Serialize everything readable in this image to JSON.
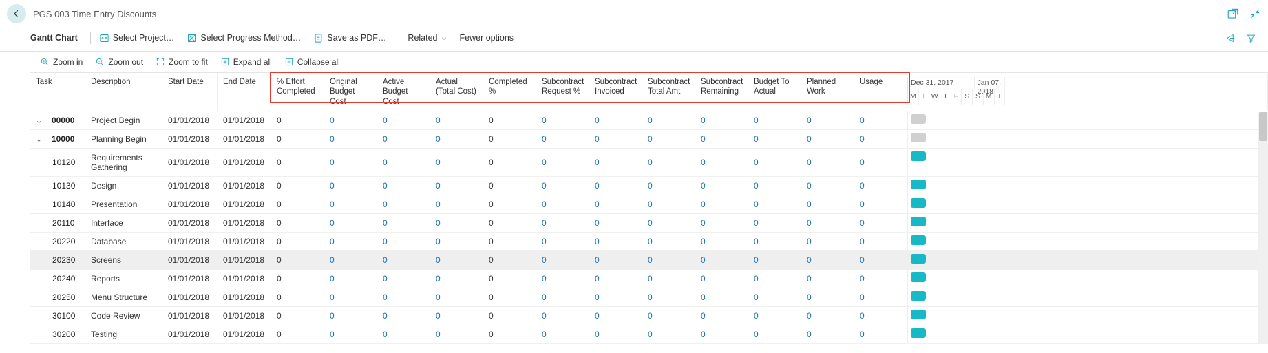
{
  "title": "PGS 003 Time Entry Discounts",
  "toolbar": {
    "gantt": "Gantt Chart",
    "select_project": "Select Project…",
    "select_progress": "Select Progress Method…",
    "save_pdf": "Save as PDF…",
    "related": "Related",
    "fewer": "Fewer options"
  },
  "subbar": {
    "zoom_in": "Zoom in",
    "zoom_out": "Zoom out",
    "zoom_fit": "Zoom to fit",
    "expand_all": "Expand all",
    "collapse_all": "Collapse all"
  },
  "columns": {
    "task": "Task",
    "desc": "Description",
    "sdate": "Start Date",
    "edate": "End Date",
    "c0": "% Effort Completed",
    "c1": "Original Budget Cost",
    "c2": "Active Budget Cost",
    "c3": "Actual (Total Cost)",
    "c4": "Completed %",
    "c5": "Subcontract Request %",
    "c6": "Subcontract Invoiced",
    "c7": "Subcontract Total Amt",
    "c8": "Subcontract Remaining",
    "c9": "Budget To Actual",
    "c10": "Planned Work",
    "c11": "Usage"
  },
  "gantt_header": {
    "date1": "Dec 31, 2017",
    "date2": "Jan 07, 2018",
    "days": [
      "M",
      "T",
      "W",
      "T",
      "F",
      "S",
      "S",
      "M",
      "T"
    ]
  },
  "rows": [
    {
      "task": "00000",
      "desc": "Project Begin",
      "sdate": "01/01/2018",
      "edate": "01/01/2018",
      "v": [
        "0",
        "0",
        "0",
        "0",
        "0",
        "0",
        "0",
        "0",
        "0",
        "0",
        "0",
        "0"
      ],
      "lvl": 0,
      "exp": true,
      "bar": "grey"
    },
    {
      "task": "10000",
      "desc": "Planning Begin",
      "sdate": "01/01/2018",
      "edate": "01/01/2018",
      "v": [
        "0",
        "0",
        "0",
        "0",
        "0",
        "0",
        "0",
        "0",
        "0",
        "0",
        "0",
        "0"
      ],
      "lvl": 1,
      "exp": true,
      "bar": "grey"
    },
    {
      "task": "10120",
      "desc": "Requirements Gathering",
      "sdate": "01/01/2018",
      "edate": "01/01/2018",
      "v": [
        "0",
        "0",
        "0",
        "0",
        "0",
        "0",
        "0",
        "0",
        "0",
        "0",
        "0",
        "0"
      ],
      "lvl": 2,
      "bar": "teal"
    },
    {
      "task": "10130",
      "desc": "Design",
      "sdate": "01/01/2018",
      "edate": "01/01/2018",
      "v": [
        "0",
        "0",
        "0",
        "0",
        "0",
        "0",
        "0",
        "0",
        "0",
        "0",
        "0",
        "0"
      ],
      "lvl": 2,
      "bar": "teal"
    },
    {
      "task": "10140",
      "desc": "Presentation",
      "sdate": "01/01/2018",
      "edate": "01/01/2018",
      "v": [
        "0",
        "0",
        "0",
        "0",
        "0",
        "0",
        "0",
        "0",
        "0",
        "0",
        "0",
        "0"
      ],
      "lvl": 2,
      "bar": "teal"
    },
    {
      "task": "20110",
      "desc": "Interface",
      "sdate": "01/01/2018",
      "edate": "01/01/2018",
      "v": [
        "0",
        "0",
        "0",
        "0",
        "0",
        "0",
        "0",
        "0",
        "0",
        "0",
        "0",
        "0"
      ],
      "lvl": 2,
      "bar": "teal"
    },
    {
      "task": "20220",
      "desc": "Database",
      "sdate": "01/01/2018",
      "edate": "01/01/2018",
      "v": [
        "0",
        "0",
        "0",
        "0",
        "0",
        "0",
        "0",
        "0",
        "0",
        "0",
        "0",
        "0"
      ],
      "lvl": 2,
      "bar": "teal"
    },
    {
      "task": "20230",
      "desc": "Screens",
      "sdate": "01/01/2018",
      "edate": "01/01/2018",
      "v": [
        "0",
        "0",
        "0",
        "0",
        "0",
        "0",
        "0",
        "0",
        "0",
        "0",
        "0",
        "0"
      ],
      "lvl": 2,
      "bar": "teal",
      "sel": true
    },
    {
      "task": "20240",
      "desc": "Reports",
      "sdate": "01/01/2018",
      "edate": "01/01/2018",
      "v": [
        "0",
        "0",
        "0",
        "0",
        "0",
        "0",
        "0",
        "0",
        "0",
        "0",
        "0",
        "0"
      ],
      "lvl": 2,
      "bar": "teal"
    },
    {
      "task": "20250",
      "desc": "Menu Structure",
      "sdate": "01/01/2018",
      "edate": "01/01/2018",
      "v": [
        "0",
        "0",
        "0",
        "0",
        "0",
        "0",
        "0",
        "0",
        "0",
        "0",
        "0",
        "0"
      ],
      "lvl": 2,
      "bar": "teal"
    },
    {
      "task": "30100",
      "desc": "Code Review",
      "sdate": "01/01/2018",
      "edate": "01/01/2018",
      "v": [
        "0",
        "0",
        "0",
        "0",
        "0",
        "0",
        "0",
        "0",
        "0",
        "0",
        "0",
        "0"
      ],
      "lvl": 2,
      "bar": "teal"
    },
    {
      "task": "30200",
      "desc": "Testing",
      "sdate": "01/01/2018",
      "edate": "01/01/2018",
      "v": [
        "0",
        "0",
        "0",
        "0",
        "0",
        "0",
        "0",
        "0",
        "0",
        "0",
        "0",
        "0"
      ],
      "lvl": 2,
      "bar": "teal"
    }
  ]
}
